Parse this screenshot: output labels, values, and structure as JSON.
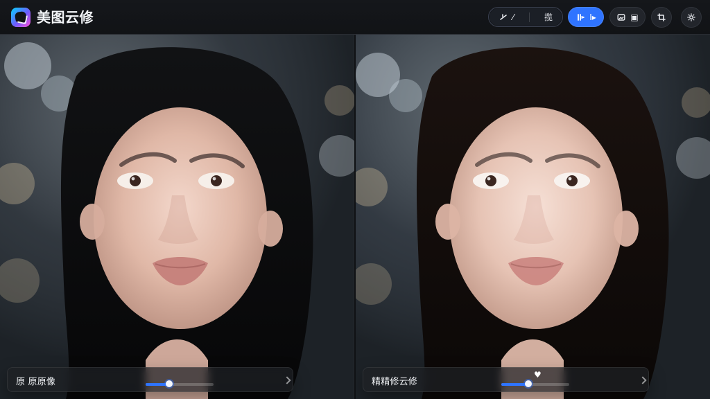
{
  "app": {
    "title": "美图云修"
  },
  "toolbar": {
    "compare": {
      "left_label": "⁄",
      "right_label": "揽"
    },
    "active_button_label": "I▸",
    "dark_button_label": "▣",
    "icons": {
      "logo": "app-logo-icon",
      "compare_left": "slash-icon",
      "compare_right": "text-icon",
      "active": "split-view-icon",
      "dark": "image-tool-icon",
      "crop": "crop-icon",
      "settings": "settings-gear-icon"
    }
  },
  "panels": {
    "left": {
      "label": "原 原原像",
      "progress": 0.35
    },
    "right": {
      "label": "精精修云修",
      "progress": 0.4,
      "heart_icon": "heart-icon"
    }
  },
  "colors": {
    "accent": "#2f74ff",
    "topbar": "#111316",
    "panel_bg": "#1a1d22"
  }
}
